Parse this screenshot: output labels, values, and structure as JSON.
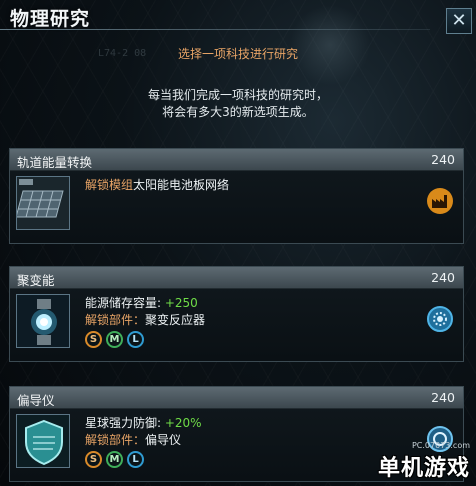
{
  "window": {
    "title": "物理研究",
    "close_glyph": "✕",
    "faint_coord": "L74-2 08"
  },
  "header": {
    "subtitle": "选择一项科技进行研究",
    "desc_line1": "每当我们完成一项科技的研究时，",
    "desc_line2": "将会有多大3的新选项生成。"
  },
  "cards": [
    {
      "name": "轨道能量转换",
      "cost": "240",
      "icon": "solar-panel-icon",
      "category_icon": "industry-factory-icon",
      "unlock_label": "解锁模组",
      "unlock_value": "太阳能电池板网络"
    },
    {
      "name": "聚变能",
      "cost": "240",
      "icon": "fusion-core-icon",
      "category_icon": "energy-gear-icon",
      "effect_label": "能源储存容量: ",
      "effect_value": "+250",
      "unlock_label": "解锁部件：",
      "unlock_value": "聚变反应器",
      "badges": [
        "S",
        "M",
        "L"
      ]
    },
    {
      "name": "偏导仪",
      "cost": "240",
      "icon": "deflector-shield-icon",
      "category_icon": "shield-ring-icon",
      "effect_label": "星球强力防御: ",
      "effect_value": "+20%",
      "unlock_label": "解锁部件：",
      "unlock_value": "偏导仪",
      "badges": [
        "S",
        "M",
        "L"
      ]
    }
  ],
  "watermark": {
    "site": "PC.07073.com",
    "brand": "单机游戏"
  },
  "colors": {
    "accent_orange": "#e8a466",
    "positive_green": "#6fdc47",
    "header_gray": "#4b575e",
    "badge_s": "#d98a2a",
    "badge_m": "#3fae5a",
    "badge_l": "#2f9bd1"
  }
}
